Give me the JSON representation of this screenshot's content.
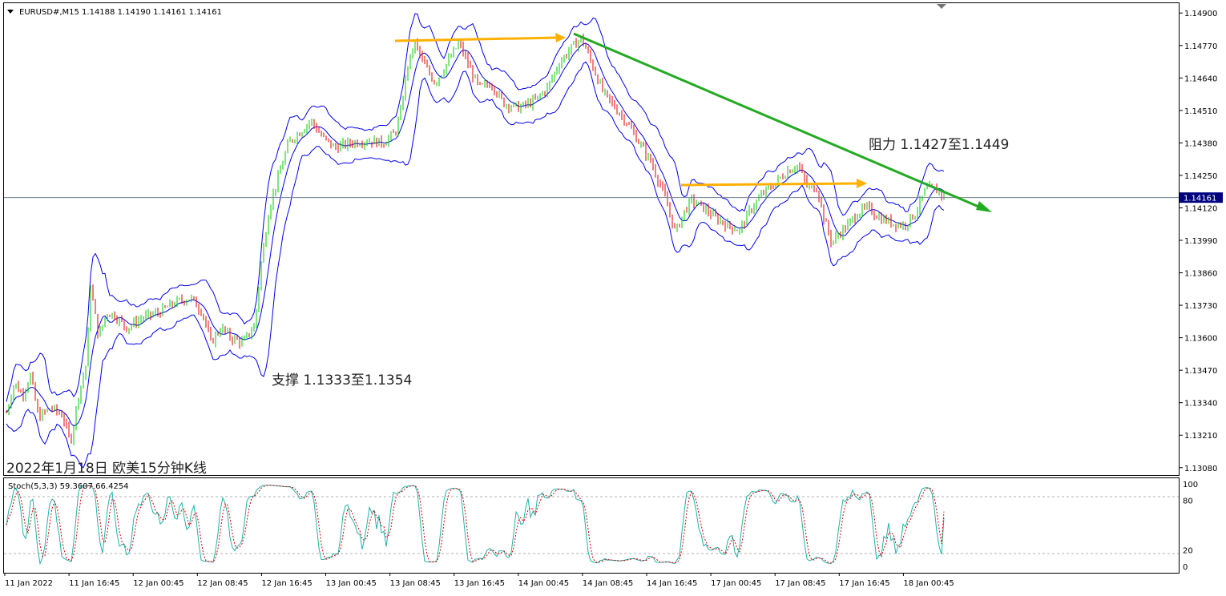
{
  "header": {
    "symbol_line": "EURUSD#,M15  1.14188 1.14190 1.14161 1.14161"
  },
  "stoch_header": "Stoch(5,3,3) 59.3607 66.4254",
  "caption": "2022年1月18日 欧美15分钟K线",
  "annotations": {
    "support": "支撑 1.1333至1.1354",
    "resistance": "阻力 1.1427至1.1449"
  },
  "current_price_label": "1.14161",
  "colors": {
    "bull": "#00c800",
    "bear": "#e00000",
    "band": "#0000ee",
    "trendline": "#22aa22",
    "arrow": "#ffb000",
    "stoch_main": "#20b2aa",
    "stoch_signal": "#dd0000",
    "price_tag_bg": "#000080"
  },
  "chart_data": [
    {
      "type": "candlestick",
      "title": "EURUSD#,M15",
      "y_ticks": [
        "1.14900",
        "1.14770",
        "1.14640",
        "1.14510",
        "1.14380",
        "1.14250",
        "1.14120",
        "1.13990",
        "1.13860",
        "1.13730",
        "1.13600",
        "1.13470",
        "1.13340",
        "1.13210",
        "1.13080"
      ],
      "x_ticks": [
        "11 Jan 2022",
        "11 Jan 16:45",
        "12 Jan 00:45",
        "12 Jan 08:45",
        "12 Jan 16:45",
        "13 Jan 00:45",
        "13 Jan 08:45",
        "13 Jan 16:45",
        "14 Jan 00:45",
        "14 Jan 08:45",
        "14 Jan 16:45",
        "17 Jan 00:45",
        "17 Jan 08:45",
        "17 Jan 16:45",
        "18 Jan 00:45"
      ],
      "ylim": [
        1.1306,
        1.1492
      ],
      "current_price": 1.14161,
      "close_path": [
        [
          0,
          1.133
        ],
        [
          10,
          1.1342
        ],
        [
          20,
          1.1337
        ],
        [
          30,
          1.1345
        ],
        [
          40,
          1.1328
        ],
        [
          55,
          1.1332
        ],
        [
          70,
          1.1329
        ],
        [
          80,
          1.1318
        ],
        [
          90,
          1.1337
        ],
        [
          100,
          1.135
        ],
        [
          105,
          1.1381
        ],
        [
          115,
          1.136
        ],
        [
          125,
          1.137
        ],
        [
          135,
          1.1369
        ],
        [
          150,
          1.1364
        ],
        [
          170,
          1.1368
        ],
        [
          190,
          1.137
        ],
        [
          210,
          1.1374
        ],
        [
          230,
          1.1376
        ],
        [
          245,
          1.137
        ],
        [
          255,
          1.1358
        ],
        [
          268,
          1.1364
        ],
        [
          280,
          1.136
        ],
        [
          295,
          1.1358
        ],
        [
          310,
          1.1365
        ],
        [
          318,
          1.139
        ],
        [
          328,
          1.1412
        ],
        [
          340,
          1.1425
        ],
        [
          352,
          1.1438
        ],
        [
          365,
          1.1442
        ],
        [
          380,
          1.1447
        ],
        [
          395,
          1.144
        ],
        [
          410,
          1.1436
        ],
        [
          430,
          1.1438
        ],
        [
          450,
          1.1439
        ],
        [
          470,
          1.1438
        ],
        [
          485,
          1.1442
        ],
        [
          492,
          1.145
        ],
        [
          500,
          1.1468
        ],
        [
          510,
          1.1478
        ],
        [
          520,
          1.147
        ],
        [
          535,
          1.1462
        ],
        [
          550,
          1.147
        ],
        [
          565,
          1.1478
        ],
        [
          578,
          1.1468
        ],
        [
          590,
          1.146
        ],
        [
          605,
          1.1462
        ],
        [
          620,
          1.1454
        ],
        [
          640,
          1.1452
        ],
        [
          660,
          1.1455
        ],
        [
          675,
          1.146
        ],
        [
          690,
          1.147
        ],
        [
          705,
          1.1476
        ],
        [
          718,
          1.148
        ],
        [
          730,
          1.147
        ],
        [
          745,
          1.1458
        ],
        [
          760,
          1.1452
        ],
        [
          775,
          1.1446
        ],
        [
          790,
          1.1438
        ],
        [
          805,
          1.143
        ],
        [
          820,
          1.1418
        ],
        [
          835,
          1.1402
        ],
        [
          845,
          1.141
        ],
        [
          855,
          1.1415
        ],
        [
          870,
          1.1412
        ],
        [
          885,
          1.1408
        ],
        [
          900,
          1.1405
        ],
        [
          915,
          1.1403
        ],
        [
          930,
          1.1412
        ],
        [
          945,
          1.1418
        ],
        [
          960,
          1.1422
        ],
        [
          975,
          1.1427
        ],
        [
          988,
          1.1429
        ],
        [
          1000,
          1.142
        ],
        [
          1012,
          1.142
        ],
        [
          1020,
          1.1408
        ],
        [
          1030,
          1.1398
        ],
        [
          1040,
          1.1402
        ],
        [
          1050,
          1.1405
        ],
        [
          1062,
          1.141
        ],
        [
          1075,
          1.1412
        ],
        [
          1090,
          1.1408
        ],
        [
          1105,
          1.1406
        ],
        [
          1120,
          1.1405
        ],
        [
          1135,
          1.141
        ],
        [
          1148,
          1.142
        ],
        [
          1160,
          1.1419
        ],
        [
          1172,
          1.14161
        ]
      ],
      "stochastic": {
        "name": "Stoch(5,3,3)",
        "main": 59.3607,
        "signal": 66.4254,
        "levels": [
          20,
          80
        ],
        "y_ticks": [
          "100",
          "80",
          "20",
          "0"
        ]
      }
    }
  ]
}
